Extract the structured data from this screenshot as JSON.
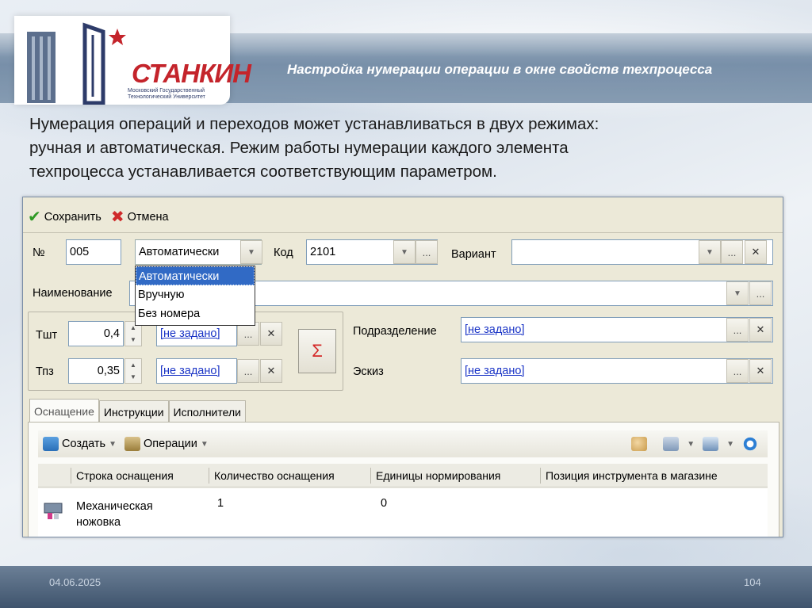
{
  "slide": {
    "title": "Настройка нумерации операции в окне свойств техпроцесса",
    "intro_line1": "Нумерация операций и переходов может устанавливаться в двух режимах:",
    "intro_line2": "ручная и автоматическая. Режим работы нумерации каждого элемента",
    "intro_line3": "техпроцесса устанавливается соответствующим параметром.",
    "date": "04.06.2025",
    "page_number": "104"
  },
  "logo": {
    "name": "СТАНКИН",
    "sub1": "Московский Государственный",
    "sub2": "Технологический Университет"
  },
  "toolbar": {
    "save_label": "Сохранить",
    "cancel_label": "Отмена"
  },
  "form": {
    "number_label": "№",
    "number_value": "005",
    "numbering_mode_value": "Автоматически",
    "code_label": "Код",
    "code_value": "2101",
    "variant_label": "Вариант",
    "variant_value": "",
    "name_label": "Наименование",
    "name_value": "",
    "tsht_label": "Тшт",
    "tsht_value": "0,4",
    "tsht_link": "[не задано]",
    "tpz_label": "Тпз",
    "tpz_value": "0,35",
    "tpz_link": "[не задано]",
    "sigma_symbol": "Σ",
    "department_label": "Подразделение",
    "department_value": "[не задано]",
    "sketch_label": "Эскиз",
    "sketch_value": "[не задано]"
  },
  "numbering_dropdown": {
    "options": [
      "Автоматически",
      "Вручную",
      "Без номера"
    ],
    "selected_index": 0
  },
  "tabs": [
    {
      "label": "Оснащение",
      "active": true
    },
    {
      "label": "Инструкции",
      "active": false
    },
    {
      "label": "Исполнители",
      "active": false
    }
  ],
  "grid_toolbar": {
    "create_label": "Создать",
    "operations_label": "Операции"
  },
  "grid": {
    "columns": [
      "Строка оснащения",
      "Количество оснащения",
      "Единицы нормирования",
      "Позиция инструмента в магазине"
    ],
    "rows": [
      {
        "name_line1": "Механическая",
        "name_line2": "ножовка",
        "quantity": "1",
        "units": "0",
        "position": ""
      }
    ]
  },
  "icons": {
    "ellipsis": "...",
    "clear": "✕",
    "dropdown": "▼",
    "check": "✔",
    "cross": "✖",
    "up": "▲",
    "down": "▼"
  }
}
